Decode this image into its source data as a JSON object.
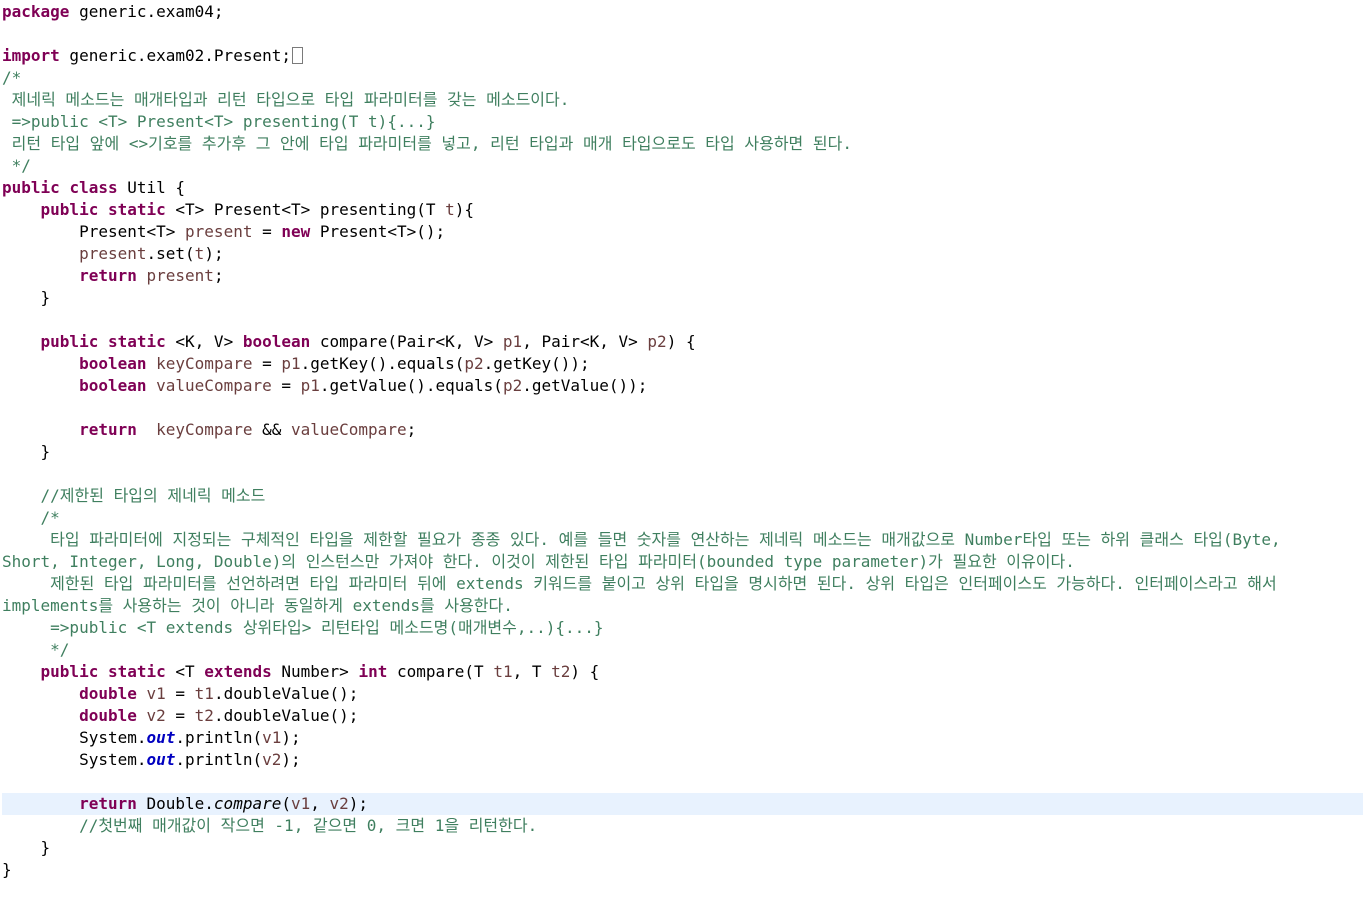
{
  "editor": {
    "language": "java",
    "current_line": 36,
    "colors": {
      "keyword": "#7f0055",
      "comment": "#3f7f5f",
      "static_field": "#0000c0",
      "local_variable": "#6a3e3e",
      "current_line_highlight": "#e8f2fe"
    },
    "lines": [
      [
        [
          "kw",
          "package"
        ],
        [
          "p",
          " generic.exam04;"
        ]
      ],
      [],
      [
        [
          "kw",
          "import"
        ],
        [
          "p",
          " generic.exam02.Present;"
        ],
        [
          "fold",
          ""
        ]
      ],
      [
        [
          "cm",
          "/*"
        ]
      ],
      [
        [
          "cm",
          " 제네릭 메소드는 매개타입과 리턴 타입으로 타입 파라미터를 갖는 메소드이다."
        ]
      ],
      [
        [
          "cm",
          " =>public <T> Present<T> presenting(T t){...}"
        ]
      ],
      [
        [
          "cm",
          " 리턴 타입 앞에 <>기호를 추가후 그 안에 타입 파라미터를 넣고, 리턴 타입과 매개 타입으로도 타입 사용하면 된다."
        ]
      ],
      [
        [
          "cm",
          " */"
        ]
      ],
      [
        [
          "kw",
          "public"
        ],
        [
          "p",
          " "
        ],
        [
          "kw",
          "class"
        ],
        [
          "p",
          " Util {"
        ]
      ],
      [
        [
          "p",
          "    "
        ],
        [
          "kw",
          "public"
        ],
        [
          "p",
          " "
        ],
        [
          "kw",
          "static"
        ],
        [
          "p",
          " <T> Present<T> presenting(T "
        ],
        [
          "var",
          "t"
        ],
        [
          "p",
          "){"
        ]
      ],
      [
        [
          "p",
          "        Present<T> "
        ],
        [
          "var",
          "present"
        ],
        [
          "p",
          " = "
        ],
        [
          "kw",
          "new"
        ],
        [
          "p",
          " Present<T>();"
        ]
      ],
      [
        [
          "p",
          "        "
        ],
        [
          "var",
          "present"
        ],
        [
          "p",
          ".set("
        ],
        [
          "var",
          "t"
        ],
        [
          "p",
          ");"
        ]
      ],
      [
        [
          "p",
          "        "
        ],
        [
          "kw",
          "return"
        ],
        [
          "p",
          " "
        ],
        [
          "var",
          "present"
        ],
        [
          "p",
          ";"
        ]
      ],
      [
        [
          "p",
          "    }"
        ]
      ],
      [],
      [
        [
          "p",
          "    "
        ],
        [
          "kw",
          "public"
        ],
        [
          "p",
          " "
        ],
        [
          "kw",
          "static"
        ],
        [
          "p",
          " <K, V> "
        ],
        [
          "kw",
          "boolean"
        ],
        [
          "p",
          " compare(Pair<K, V> "
        ],
        [
          "var",
          "p1"
        ],
        [
          "p",
          ", Pair<K, V> "
        ],
        [
          "var",
          "p2"
        ],
        [
          "p",
          ") {"
        ]
      ],
      [
        [
          "p",
          "        "
        ],
        [
          "kw",
          "boolean"
        ],
        [
          "p",
          " "
        ],
        [
          "var",
          "keyCompare"
        ],
        [
          "p",
          " = "
        ],
        [
          "var",
          "p1"
        ],
        [
          "p",
          ".getKey().equals("
        ],
        [
          "var",
          "p2"
        ],
        [
          "p",
          ".getKey());"
        ]
      ],
      [
        [
          "p",
          "        "
        ],
        [
          "kw",
          "boolean"
        ],
        [
          "p",
          " "
        ],
        [
          "var",
          "valueCompare"
        ],
        [
          "p",
          " = "
        ],
        [
          "var",
          "p1"
        ],
        [
          "p",
          ".getValue().equals("
        ],
        [
          "var",
          "p2"
        ],
        [
          "p",
          ".getValue());"
        ]
      ],
      [],
      [
        [
          "p",
          "        "
        ],
        [
          "kw",
          "return"
        ],
        [
          "p",
          "  "
        ],
        [
          "var",
          "keyCompare"
        ],
        [
          "p",
          " && "
        ],
        [
          "var",
          "valueCompare"
        ],
        [
          "p",
          ";"
        ]
      ],
      [
        [
          "p",
          "    }"
        ]
      ],
      [],
      [
        [
          "p",
          "    "
        ],
        [
          "cm",
          "//제한된 타입의 제네릭 메소드"
        ]
      ],
      [
        [
          "p",
          "    "
        ],
        [
          "cm",
          "/*"
        ]
      ],
      [
        [
          "cm",
          "     타입 파라미터에 지정되는 구체적인 타입을 제한할 필요가 종종 있다. 예를 들면 숫자를 연산하는 제네릭 메소드는 매개값으로 Number타입 또는 하위 클래스 타입(Byte,"
        ]
      ],
      [
        [
          "cm",
          "Short, Integer, Long, Double)의 인스턴스만 가져야 한다. 이것이 제한된 타입 파라미터(bounded type parameter)가 필요한 이유이다."
        ]
      ],
      [
        [
          "cm",
          "     제한된 타입 파라미터를 선언하려면 타입 파라미터 뒤에 extends 키워드를 붙이고 상위 타입을 명시하면 된다. 상위 타입은 인터페이스도 가능하다. 인터페이스라고 해서"
        ]
      ],
      [
        [
          "cm",
          "implements를 사용하는 것이 아니라 동일하게 extends를 사용한다."
        ]
      ],
      [
        [
          "cm",
          "     =>public <T extends 상위타입> 리턴타입 메소드명(매개변수,..){...}"
        ]
      ],
      [
        [
          "cm",
          "     */"
        ]
      ],
      [
        [
          "p",
          "    "
        ],
        [
          "kw",
          "public"
        ],
        [
          "p",
          " "
        ],
        [
          "kw",
          "static"
        ],
        [
          "p",
          " <T "
        ],
        [
          "kw",
          "extends"
        ],
        [
          "p",
          " Number> "
        ],
        [
          "kw",
          "int"
        ],
        [
          "p",
          " compare(T "
        ],
        [
          "var",
          "t1"
        ],
        [
          "p",
          ", T "
        ],
        [
          "var",
          "t2"
        ],
        [
          "p",
          ") {"
        ]
      ],
      [
        [
          "p",
          "        "
        ],
        [
          "kw",
          "double"
        ],
        [
          "p",
          " "
        ],
        [
          "var",
          "v1"
        ],
        [
          "p",
          " = "
        ],
        [
          "var",
          "t1"
        ],
        [
          "p",
          ".doubleValue();"
        ]
      ],
      [
        [
          "p",
          "        "
        ],
        [
          "kw",
          "double"
        ],
        [
          "p",
          " "
        ],
        [
          "var",
          "v2"
        ],
        [
          "p",
          " = "
        ],
        [
          "var",
          "t2"
        ],
        [
          "p",
          ".doubleValue();"
        ]
      ],
      [
        [
          "p",
          "        System."
        ],
        [
          "fld",
          "out"
        ],
        [
          "p",
          ".println("
        ],
        [
          "var",
          "v1"
        ],
        [
          "p",
          ");"
        ]
      ],
      [
        [
          "p",
          "        System."
        ],
        [
          "fld",
          "out"
        ],
        [
          "p",
          ".println("
        ],
        [
          "var",
          "v2"
        ],
        [
          "p",
          ");"
        ]
      ],
      [],
      [
        [
          "p",
          "        "
        ],
        [
          "kw",
          "return"
        ],
        [
          "p",
          " Double."
        ],
        [
          "sm",
          "compare"
        ],
        [
          "p",
          "("
        ],
        [
          "var",
          "v1"
        ],
        [
          "p",
          ", "
        ],
        [
          "var",
          "v2"
        ],
        [
          "p",
          ");"
        ]
      ],
      [
        [
          "p",
          "        "
        ],
        [
          "cm",
          "//첫번째 매개값이 작으면 -1, 같으면 0, 크면 1을 리턴한다."
        ]
      ],
      [
        [
          "p",
          "    }"
        ]
      ],
      [
        [
          "p",
          "}"
        ]
      ]
    ]
  }
}
